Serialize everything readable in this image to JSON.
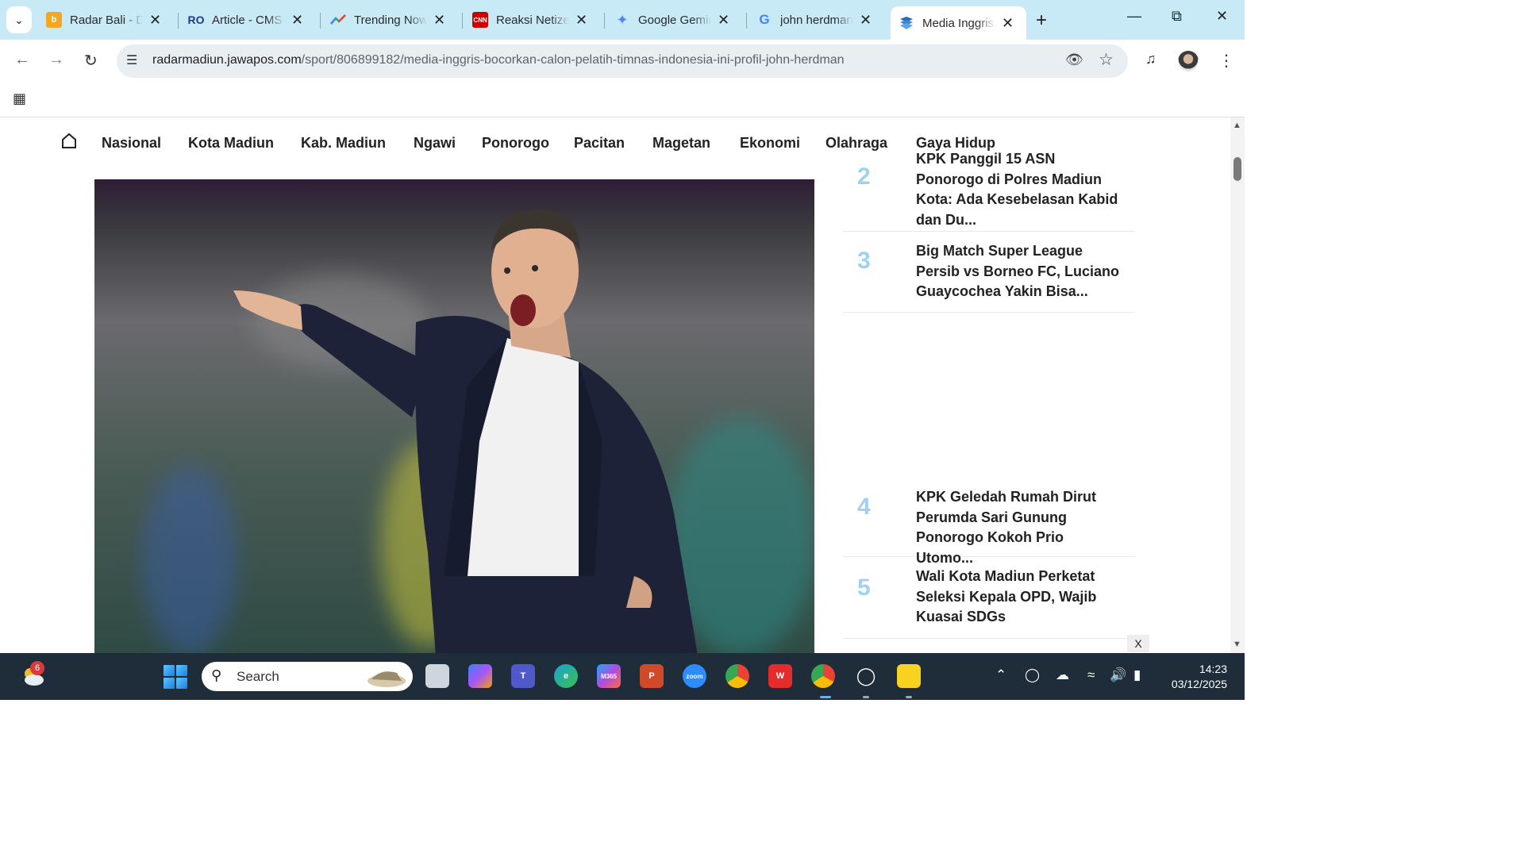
{
  "tabs": [
    {
      "title": "Radar Bali - D",
      "icon": "radarbali-favicon",
      "color": "#f5a623"
    },
    {
      "title": "Article - CMS",
      "icon": "cms-favicon",
      "color": "#1d3b8f"
    },
    {
      "title": "Trending Now",
      "icon": "trending-favicon",
      "color": "#e94235"
    },
    {
      "title": "Reaksi Netizen",
      "icon": "cnn-favicon",
      "color": "#cc0000"
    },
    {
      "title": "Google Gemini",
      "icon": "gemini-favicon",
      "color": "#4f86f7"
    },
    {
      "title": "john herdman",
      "icon": "google-favicon",
      "color": "#4285f4"
    },
    {
      "title": "Media Inggris",
      "icon": "jawapos-favicon",
      "color": "#1e6fb8"
    }
  ],
  "toolbar": {
    "url_host": "radarmadiun.jawapos.com",
    "url_path": "/sport/806899182/media-inggris-bocorkan-calon-pelatih-timnas-indonesia-ini-profil-john-herdman"
  },
  "nav": {
    "links": [
      "Nasional",
      "Kota Madiun",
      "Kab. Madiun",
      "Ngawi",
      "Ponorogo",
      "Pacitan",
      "Magetan",
      "Ekonomi",
      "Olahraga",
      "Gaya Hidup"
    ]
  },
  "sidebar": {
    "items": [
      {
        "num": "2",
        "title": "KPK Panggil 15 ASN Ponorogo di Polres Madiun Kota: Ada Kesebelasan Kabid dan Du..."
      },
      {
        "num": "3",
        "title": "Big Match Super League Persib vs Borneo FC, Luciano Guaycochea Yakin Bisa..."
      },
      {
        "num": "4",
        "title": "KPK Geledah Rumah Dirut Perumda Sari Gunung Ponorogo Kokoh Prio Utomo..."
      },
      {
        "num": "5",
        "title": "Wali Kota Madiun Perketat Seleksi Kepala OPD, Wajib Kuasai SDGs"
      }
    ],
    "close_ad": "X"
  },
  "taskbar": {
    "weather_badge": "6",
    "search_label": "Search",
    "time": "14:23",
    "date": "03/12/2025"
  }
}
